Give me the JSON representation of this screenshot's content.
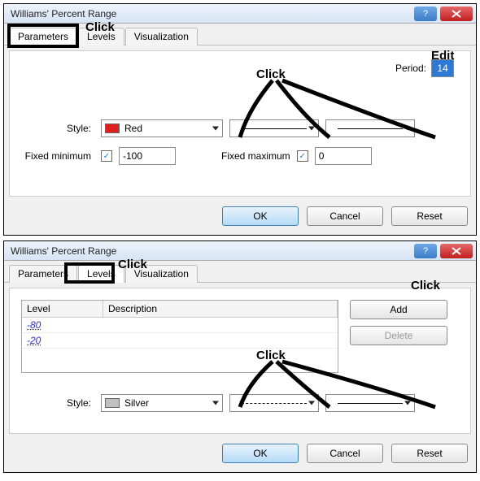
{
  "dialog1": {
    "title": "Williams' Percent Range",
    "tabs": {
      "parameters": "Parameters",
      "levels": "Levels",
      "visualization": "Visualization"
    },
    "period_label": "Period:",
    "period_value": "14",
    "style_label": "Style:",
    "style_color_name": "Red",
    "fixed_min_label": "Fixed minimum",
    "fixed_min_value": "-100",
    "fixed_max_label": "Fixed maximum",
    "fixed_max_value": "0",
    "ok": "OK",
    "cancel": "Cancel",
    "reset": "Reset",
    "ann_tab": "Click",
    "ann_period": "Edit",
    "ann_style": "Click"
  },
  "dialog2": {
    "title": "Williams' Percent Range",
    "tabs": {
      "parameters": "Parameters",
      "levels": "Levels",
      "visualization": "Visualization"
    },
    "header_level": "Level",
    "header_desc": "Description",
    "rows": [
      {
        "level": "-80",
        "desc": ""
      },
      {
        "level": "-20",
        "desc": ""
      }
    ],
    "add": "Add",
    "delete": "Delete",
    "style_label": "Style:",
    "style_color_name": "Silver",
    "ok": "OK",
    "cancel": "Cancel",
    "reset": "Reset",
    "ann_tab": "Click",
    "ann_add": "Click",
    "ann_style": "Click"
  }
}
